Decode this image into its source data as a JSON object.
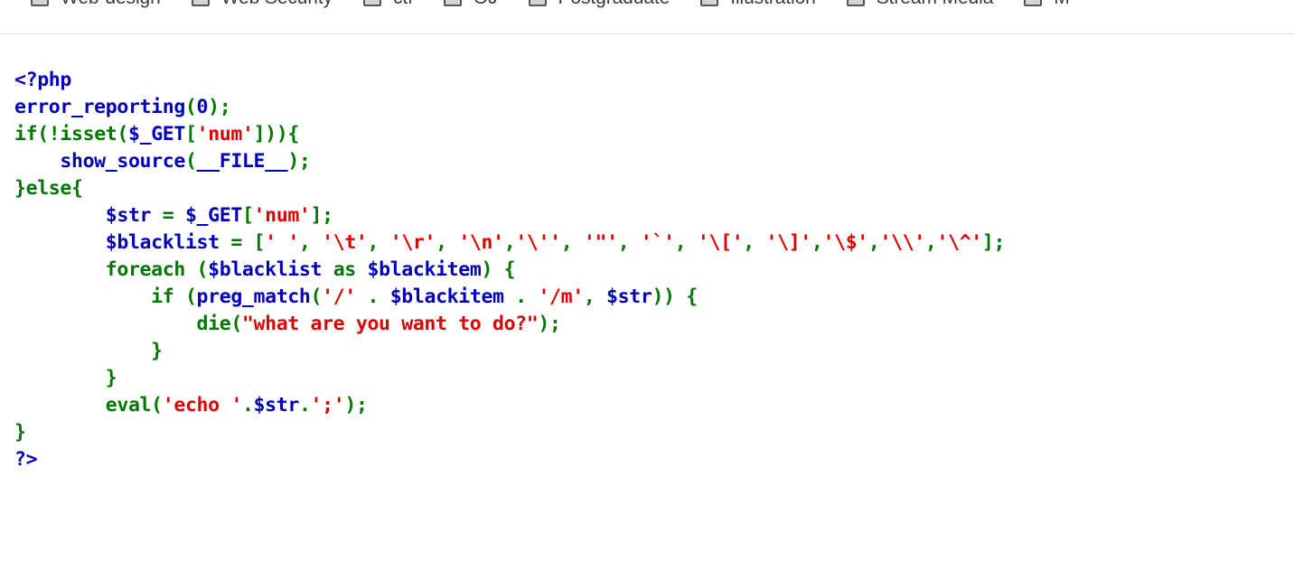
{
  "category_bar": {
    "items": [
      {
        "label": "Web-design",
        "checked": false
      },
      {
        "label": "Web Security",
        "checked": false
      },
      {
        "label": "ctf",
        "checked": false
      },
      {
        "label": "OJ",
        "checked": false
      },
      {
        "label": "Postgraduate",
        "checked": false
      },
      {
        "label": "Illustration",
        "checked": false
      },
      {
        "label": "Stream Media",
        "checked": false
      },
      {
        "label": "M",
        "checked": false
      }
    ]
  },
  "source": {
    "language": "php",
    "lines": [
      [
        {
          "t": "<?php",
          "c": "d"
        }
      ],
      [
        {
          "t": "error_reporting",
          "c": "d"
        },
        {
          "t": "(",
          "c": "k"
        },
        {
          "t": "0",
          "c": "d"
        },
        {
          "t": ")",
          "c": "k"
        },
        {
          "t": ";",
          "c": "k"
        }
      ],
      [
        {
          "t": "if",
          "c": "k"
        },
        {
          "t": "(!",
          "c": "k"
        },
        {
          "t": "isset",
          "c": "k"
        },
        {
          "t": "(",
          "c": "k"
        },
        {
          "t": "$_GET",
          "c": "d"
        },
        {
          "t": "[",
          "c": "k"
        },
        {
          "t": "'num'",
          "c": "s"
        },
        {
          "t": "]))",
          "c": "k"
        },
        {
          "t": "{",
          "c": "k"
        }
      ],
      [
        {
          "t": "    ",
          "c": "d"
        },
        {
          "t": "show_source",
          "c": "d"
        },
        {
          "t": "(",
          "c": "k"
        },
        {
          "t": "__FILE__",
          "c": "d"
        },
        {
          "t": ")",
          "c": "k"
        },
        {
          "t": ";",
          "c": "k"
        }
      ],
      [
        {
          "t": "}",
          "c": "k"
        },
        {
          "t": "else",
          "c": "k"
        },
        {
          "t": "{",
          "c": "k"
        }
      ],
      [
        {
          "t": "        ",
          "c": "d"
        },
        {
          "t": "$str",
          "c": "d"
        },
        {
          "t": " = ",
          "c": "k"
        },
        {
          "t": "$_GET",
          "c": "d"
        },
        {
          "t": "[",
          "c": "k"
        },
        {
          "t": "'num'",
          "c": "s"
        },
        {
          "t": "]",
          "c": "k"
        },
        {
          "t": ";",
          "c": "k"
        }
      ],
      [
        {
          "t": "        ",
          "c": "d"
        },
        {
          "t": "$blacklist",
          "c": "d"
        },
        {
          "t": " = ",
          "c": "k"
        },
        {
          "t": "[",
          "c": "k"
        },
        {
          "t": "' '",
          "c": "s"
        },
        {
          "t": ", ",
          "c": "k"
        },
        {
          "t": "'\\t'",
          "c": "s"
        },
        {
          "t": ", ",
          "c": "k"
        },
        {
          "t": "'\\r'",
          "c": "s"
        },
        {
          "t": ", ",
          "c": "k"
        },
        {
          "t": "'\\n'",
          "c": "s"
        },
        {
          "t": ",",
          "c": "k"
        },
        {
          "t": "'\\''",
          "c": "s"
        },
        {
          "t": ", ",
          "c": "k"
        },
        {
          "t": "'\"'",
          "c": "s"
        },
        {
          "t": ", ",
          "c": "k"
        },
        {
          "t": "'`'",
          "c": "s"
        },
        {
          "t": ", ",
          "c": "k"
        },
        {
          "t": "'\\['",
          "c": "s"
        },
        {
          "t": ", ",
          "c": "k"
        },
        {
          "t": "'\\]'",
          "c": "s"
        },
        {
          "t": ",",
          "c": "k"
        },
        {
          "t": "'\\$'",
          "c": "s"
        },
        {
          "t": ",",
          "c": "k"
        },
        {
          "t": "'\\\\'",
          "c": "s"
        },
        {
          "t": ",",
          "c": "k"
        },
        {
          "t": "'\\^'",
          "c": "s"
        },
        {
          "t": "]",
          "c": "k"
        },
        {
          "t": ";",
          "c": "k"
        }
      ],
      [
        {
          "t": "        ",
          "c": "d"
        },
        {
          "t": "foreach",
          "c": "k"
        },
        {
          "t": " (",
          "c": "k"
        },
        {
          "t": "$blacklist",
          "c": "d"
        },
        {
          "t": " ",
          "c": "k"
        },
        {
          "t": "as",
          "c": "k"
        },
        {
          "t": " ",
          "c": "k"
        },
        {
          "t": "$blackitem",
          "c": "d"
        },
        {
          "t": ") ",
          "c": "k"
        },
        {
          "t": "{",
          "c": "k"
        }
      ],
      [
        {
          "t": "            ",
          "c": "d"
        },
        {
          "t": "if",
          "c": "k"
        },
        {
          "t": " (",
          "c": "k"
        },
        {
          "t": "preg_match",
          "c": "d"
        },
        {
          "t": "(",
          "c": "k"
        },
        {
          "t": "'/'",
          "c": "s"
        },
        {
          "t": " . ",
          "c": "k"
        },
        {
          "t": "$blackitem",
          "c": "d"
        },
        {
          "t": " . ",
          "c": "k"
        },
        {
          "t": "'/m'",
          "c": "s"
        },
        {
          "t": ", ",
          "c": "k"
        },
        {
          "t": "$str",
          "c": "d"
        },
        {
          "t": ")) ",
          "c": "k"
        },
        {
          "t": "{",
          "c": "k"
        }
      ],
      [
        {
          "t": "                ",
          "c": "d"
        },
        {
          "t": "die",
          "c": "k"
        },
        {
          "t": "(",
          "c": "k"
        },
        {
          "t": "\"what are you want to do?\"",
          "c": "s"
        },
        {
          "t": ")",
          "c": "k"
        },
        {
          "t": ";",
          "c": "k"
        }
      ],
      [
        {
          "t": "            ",
          "c": "d"
        },
        {
          "t": "}",
          "c": "k"
        }
      ],
      [
        {
          "t": "        ",
          "c": "d"
        },
        {
          "t": "}",
          "c": "k"
        }
      ],
      [
        {
          "t": "        ",
          "c": "d"
        },
        {
          "t": "eval",
          "c": "k"
        },
        {
          "t": "(",
          "c": "k"
        },
        {
          "t": "'echo '",
          "c": "s"
        },
        {
          "t": ".",
          "c": "k"
        },
        {
          "t": "$str",
          "c": "d"
        },
        {
          "t": ".",
          "c": "k"
        },
        {
          "t": "';'",
          "c": "s"
        },
        {
          "t": ")",
          "c": "k"
        },
        {
          "t": ";",
          "c": "k"
        }
      ],
      [
        {
          "t": "}",
          "c": "k"
        }
      ],
      [
        {
          "t": "?>",
          "c": "d"
        }
      ]
    ],
    "plain_text": "<?php\nerror_reporting(0);\nif(!isset($_GET['num'])){\n    show_source(__FILE__);\n}else{\n        $str = $_GET['num'];\n        $blacklist = [' ', '\\t', '\\r', '\\n','\\'', '\"', '`', '\\[', '\\]','\\$','\\\\','\\^'];\n        foreach ($blacklist as $blackitem) {\n            if (preg_match('/' . $blackitem . '/m', $str)) {\n                die(\"what are you want to do?\");\n            }\n        }\n        eval('echo '.$str.';');\n}\n?>"
  },
  "colors": {
    "keyword_green": "#007700",
    "default_blue": "#0000bb",
    "string_red": "#dd0000",
    "comment_orange": "#ff8000",
    "page_background": "#ffffff",
    "checkbox_fill": "#d4d4d4",
    "checkbox_border": "#565656",
    "label_text": "#3b3b3b",
    "divider": "#e2e2e2"
  }
}
